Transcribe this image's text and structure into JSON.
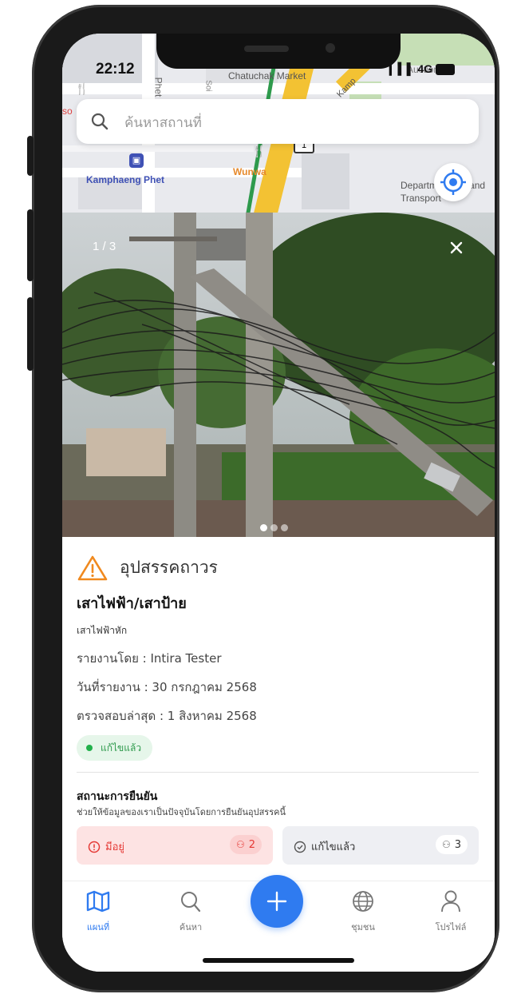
{
  "status_bar": {
    "time": "22:12",
    "signal": "4G"
  },
  "map": {
    "labels": {
      "market": "Chatuchak Market",
      "station": "Kamphaeng Phet",
      "restaurant": "Wunwa",
      "dept": "Department of Land Transport",
      "road": "Kamp",
      "auction": "Auction Ins",
      "phet": "Phet",
      "soi": "Soi",
      "so": "so",
      "route_number": "1"
    },
    "icons": {
      "search": "search-icon",
      "locate": "locate-icon",
      "train": "train-icon",
      "food": "restaurant-icon"
    }
  },
  "search": {
    "placeholder": "ค้นหาสถานที่"
  },
  "photo": {
    "counter": "1 / 3",
    "total": 3,
    "current": 1
  },
  "report": {
    "hazard_type": "อุปสรรคถาวร",
    "category": "เสาไฟฟ้า/เสาป้าย",
    "description": "เสาไฟฟ้าหัก",
    "reported_by": "รายงานโดย : Intira Tester",
    "reported_date": "วันที่รายงาน : 30 กรกฎาคม 2568",
    "last_checked": "ตรวจสอบล่าสุด : 1 สิงหาคม 2568",
    "status": "แก้ไขแล้ว",
    "status_color": "#22b04b"
  },
  "verification": {
    "title": "สถานะการยืนยัน",
    "subtitle": "ช่วยให้ข้อมูลของเราเป็นปัจจุบันโดยการยืนยันอุปสรรคนี้",
    "exists_label": "มีอยู่",
    "exists_count": "2",
    "resolved_label": "แก้ไขแล้ว",
    "resolved_count": "3",
    "exists_color": "#e53935"
  },
  "tabs": {
    "map": "แผนที่",
    "search": "ค้นหา",
    "community": "ชุมชน",
    "profile": "โปรไฟล์",
    "active_color": "#2f7bf0"
  }
}
